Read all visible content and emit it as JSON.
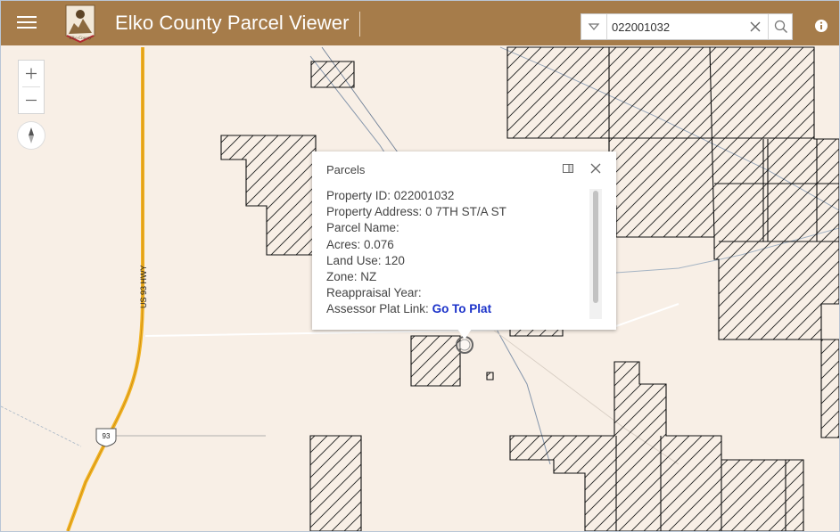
{
  "header": {
    "title": "Elko County Parcel Viewer",
    "logo_text": "Elko County",
    "bg_color": "#a67c4a"
  },
  "search": {
    "value": "022001032",
    "icons": [
      "chevron-down-icon",
      "close-icon",
      "search-icon"
    ]
  },
  "map": {
    "bg_color": "#f8efe6",
    "road_label": "US 93 HWY",
    "shield_label": "93",
    "highway_color": "#f2b324"
  },
  "popup": {
    "title": "Parcels",
    "fields": [
      {
        "label": "Property ID:",
        "value": "022001032"
      },
      {
        "label": "Property Address:",
        "value": "0 7TH ST/A ST"
      },
      {
        "label": "Parcel Name:",
        "value": ""
      },
      {
        "label": "Acres:",
        "value": "0.076"
      },
      {
        "label": "Land Use:",
        "value": "120"
      },
      {
        "label": "Zone:",
        "value": "NZ"
      },
      {
        "label": "Reappraisal Year:",
        "value": ""
      }
    ],
    "link_label": "Assessor Plat Link:",
    "link_text": "Go To Plat",
    "link_color": "#1a31c9"
  }
}
